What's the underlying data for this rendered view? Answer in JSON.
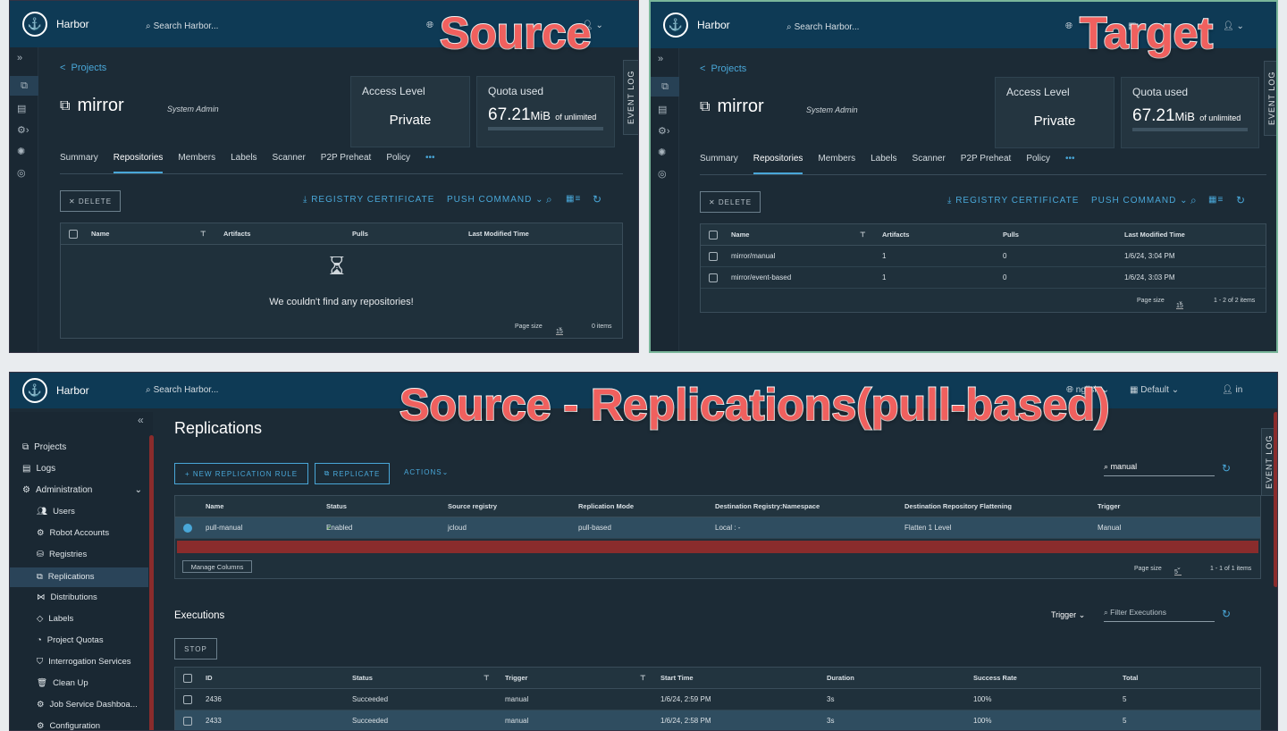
{
  "brand": "Harbor",
  "search_placeholder": "Search Harbor...",
  "overlays": {
    "source": "Source",
    "target": "Target",
    "replications": "Source - Replications(pull-based)"
  },
  "project": {
    "crumb": "Projects",
    "name": "mirror",
    "role": "System Admin",
    "access_title": "Access Level",
    "access_value": "Private",
    "quota_title": "Quota used",
    "quota_value": "67.21",
    "quota_unit": "MiB",
    "quota_suffix": "of unlimited",
    "tabs": [
      "Summary",
      "Repositories",
      "Members",
      "Labels",
      "Scanner",
      "P2P Preheat",
      "Policy",
      "•••"
    ],
    "delete": "DELETE",
    "registry_cert": "REGISTRY CERTIFICATE",
    "push_cmd": "PUSH COMMAND",
    "cols": [
      "Name",
      "Artifacts",
      "Pulls",
      "Last Modified Time"
    ]
  },
  "source": {
    "empty": "We couldn't find any repositories!",
    "page_size_label": "Page size",
    "page_size": "15",
    "count": "0 items"
  },
  "target": {
    "rows": [
      {
        "name": "mirror/manual",
        "artifacts": "1",
        "pulls": "0",
        "time": "1/6/24, 3:04 PM"
      },
      {
        "name": "mirror/event-based",
        "artifacts": "1",
        "pulls": "0",
        "time": "1/6/24, 3:03 PM"
      }
    ],
    "page_size_label": "Page size",
    "page_size": "15",
    "count": "1 - 2 of 2 items"
  },
  "header_right": {
    "lang": "English",
    "theme": "Default",
    "user": "admin",
    "lang_short": "nglish",
    "user_short": "in"
  },
  "event_log": "EVENT LOG",
  "nav": {
    "projects": "Projects",
    "logs": "Logs",
    "admin": "Administration",
    "sub": [
      "Users",
      "Robot Accounts",
      "Registries",
      "Replications",
      "Distributions",
      "Labels",
      "Project Quotas",
      "Interrogation Services",
      "Clean Up",
      "Job Service Dashboa...",
      "Configuration"
    ]
  },
  "repl": {
    "title": "Replications",
    "new_rule": "NEW REPLICATION RULE",
    "replicate": "REPLICATE",
    "actions": "ACTIONS",
    "search": "manual",
    "cols": [
      "Name",
      "Status",
      "Source registry",
      "Replication Mode",
      "Destination Registry:Namespace",
      "Destination Repository Flattening",
      "Trigger"
    ],
    "row": {
      "name": "pull-manual",
      "status": "Enabled",
      "source": "jcloud",
      "mode": "pull-based",
      "dest": "Local : -",
      "flatten": "Flatten 1 Level",
      "trigger": "Manual"
    },
    "manage": "Manage Columns",
    "page_size_label": "Page size",
    "page_size": "5",
    "count": "1 - 1 of 1 items"
  },
  "exec": {
    "title": "Executions",
    "trigger_filter": "Trigger",
    "filter_placeholder": "Filter Executions",
    "stop": "STOP",
    "cols": [
      "ID",
      "Status",
      "Trigger",
      "Start Time",
      "Duration",
      "Success Rate",
      "Total"
    ],
    "rows": [
      {
        "id": "2436",
        "status": "Succeeded",
        "trigger": "manual",
        "start": "1/6/24, 2:59 PM",
        "duration": "3s",
        "rate": "100%",
        "total": "5"
      },
      {
        "id": "2433",
        "status": "Succeeded",
        "trigger": "manual",
        "start": "1/6/24, 2:58 PM",
        "duration": "3s",
        "rate": "100%",
        "total": "5"
      }
    ]
  }
}
